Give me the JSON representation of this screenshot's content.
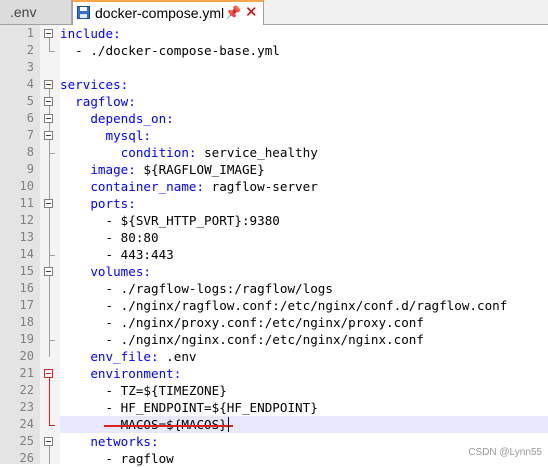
{
  "tabs": [
    {
      "label": ".env",
      "active": false
    },
    {
      "label": "docker-compose.yml",
      "active": true,
      "pin_icon": "pin-icon",
      "close_icon": "close-icon"
    }
  ],
  "lines": [
    {
      "n": "1",
      "segs": [
        {
          "t": "include:",
          "c": "k"
        }
      ]
    },
    {
      "n": "2",
      "segs": [
        {
          "t": "  - ./docker-compose-base.yml",
          "c": "s"
        }
      ]
    },
    {
      "n": "3",
      "segs": []
    },
    {
      "n": "4",
      "segs": [
        {
          "t": "services:",
          "c": "k"
        }
      ]
    },
    {
      "n": "5",
      "segs": [
        {
          "t": "  ragflow:",
          "c": "k"
        }
      ]
    },
    {
      "n": "6",
      "segs": [
        {
          "t": "    depends_on:",
          "c": "k"
        }
      ]
    },
    {
      "n": "7",
      "segs": [
        {
          "t": "      mysql:",
          "c": "k"
        }
      ]
    },
    {
      "n": "8",
      "segs": [
        {
          "t": "        condition:",
          "c": "k"
        },
        {
          "t": " service_healthy",
          "c": "s"
        }
      ]
    },
    {
      "n": "9",
      "segs": [
        {
          "t": "    image:",
          "c": "k"
        },
        {
          "t": " ${RAGFLOW_IMAGE}",
          "c": "s"
        }
      ]
    },
    {
      "n": "10",
      "segs": [
        {
          "t": "    container_name:",
          "c": "k"
        },
        {
          "t": " ragflow-server",
          "c": "s"
        }
      ]
    },
    {
      "n": "11",
      "segs": [
        {
          "t": "    ports:",
          "c": "k"
        }
      ]
    },
    {
      "n": "12",
      "segs": [
        {
          "t": "      - ${SVR_HTTP_PORT}:9380",
          "c": "s"
        }
      ]
    },
    {
      "n": "13",
      "segs": [
        {
          "t": "      - 80:80",
          "c": "s"
        }
      ]
    },
    {
      "n": "14",
      "segs": [
        {
          "t": "      - 443:443",
          "c": "s"
        }
      ]
    },
    {
      "n": "15",
      "segs": [
        {
          "t": "    volumes:",
          "c": "k"
        }
      ]
    },
    {
      "n": "16",
      "segs": [
        {
          "t": "      - ./ragflow-logs:/ragflow/logs",
          "c": "s"
        }
      ]
    },
    {
      "n": "17",
      "segs": [
        {
          "t": "      - ./nginx/ragflow.conf:/etc/nginx/conf.d/ragflow.conf",
          "c": "s"
        }
      ]
    },
    {
      "n": "18",
      "segs": [
        {
          "t": "      - ./nginx/proxy.conf:/etc/nginx/proxy.conf",
          "c": "s"
        }
      ]
    },
    {
      "n": "19",
      "segs": [
        {
          "t": "      - ./nginx/nginx.conf:/etc/nginx/nginx.conf",
          "c": "s"
        }
      ]
    },
    {
      "n": "20",
      "segs": [
        {
          "t": "    env_file:",
          "c": "k"
        },
        {
          "t": " .env",
          "c": "s"
        }
      ]
    },
    {
      "n": "21",
      "segs": [
        {
          "t": "    environment:",
          "c": "k"
        }
      ]
    },
    {
      "n": "22",
      "segs": [
        {
          "t": "      - TZ=${TIMEZONE}",
          "c": "s"
        }
      ]
    },
    {
      "n": "23",
      "segs": [
        {
          "t": "      - HF_ENDPOINT=${HF_ENDPOINT}",
          "c": "s"
        }
      ]
    },
    {
      "n": "24",
      "segs": [
        {
          "t": "      - MACOS=${MACOS}",
          "c": "s"
        }
      ],
      "highlighted": true,
      "struck": true
    },
    {
      "n": "25",
      "segs": [
        {
          "t": "    networks:",
          "c": "k"
        }
      ]
    },
    {
      "n": "26",
      "segs": [
        {
          "t": "      - ragflow",
          "c": "s"
        }
      ]
    }
  ],
  "fold_markers": [
    1,
    4,
    5,
    6,
    7,
    11,
    15,
    21,
    25
  ],
  "colors": {
    "keyword": "#0000ff",
    "annotation": "#e02020",
    "highlight_line": "#e8e8ff",
    "active_tab_accent": "#f5a54a"
  },
  "watermark": "CSDN @Lynn55"
}
